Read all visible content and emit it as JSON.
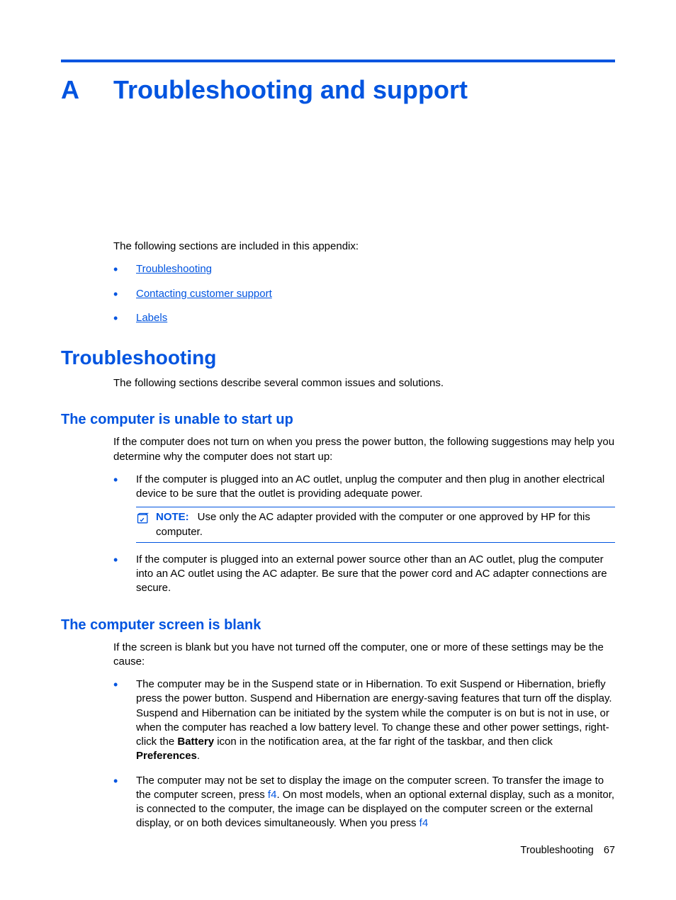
{
  "appendix": {
    "letter": "A",
    "title": "Troubleshooting and support"
  },
  "intro": "The following sections are included in this appendix:",
  "toc": [
    "Troubleshooting",
    "Contacting customer support",
    "Labels"
  ],
  "section": {
    "title": "Troubleshooting",
    "intro": "The following sections describe several common issues and solutions."
  },
  "sub1": {
    "title": "The computer is unable to start up",
    "intro": "If the computer does not turn on when you press the power button, the following suggestions may help you determine why the computer does not start up:",
    "b1": "If the computer is plugged into an AC outlet, unplug the computer and then plug in another electrical device to be sure that the outlet is providing adequate power.",
    "note_label": "NOTE:",
    "note_text": "Use only the AC adapter provided with the computer or one approved by HP for this computer.",
    "b2": "If the computer is plugged into an external power source other than an AC outlet, plug the computer into an AC outlet using the AC adapter. Be sure that the power cord and AC adapter connections are secure."
  },
  "sub2": {
    "title": "The computer screen is blank",
    "intro": "If the screen is blank but you have not turned off the computer, one or more of these settings may be the cause:",
    "b1a": "The computer may be in the Suspend state or in Hibernation. To exit Suspend or Hibernation, briefly press the power button. Suspend and Hibernation are energy-saving features that turn off the display. Suspend and Hibernation can be initiated by the system while the computer is on but is not in use, or when the computer has reached a low battery level. To change these and other power settings, right-click the ",
    "b1_bold1": "Battery",
    "b1b": " icon in the notification area, at the far right of the taskbar, and then click ",
    "b1_bold2": "Preferences",
    "b1c": ".",
    "b2a": "The computer may not be set to display the image on the computer screen. To transfer the image to the computer screen, press ",
    "b2_key1": "f4",
    "b2b": ". On most models, when an optional external display, such as a monitor, is connected to the computer, the image can be displayed on the computer screen or the external display, or on both devices simultaneously. When you press ",
    "b2_key2": "f4"
  },
  "footer": {
    "label": "Troubleshooting",
    "page": "67"
  }
}
